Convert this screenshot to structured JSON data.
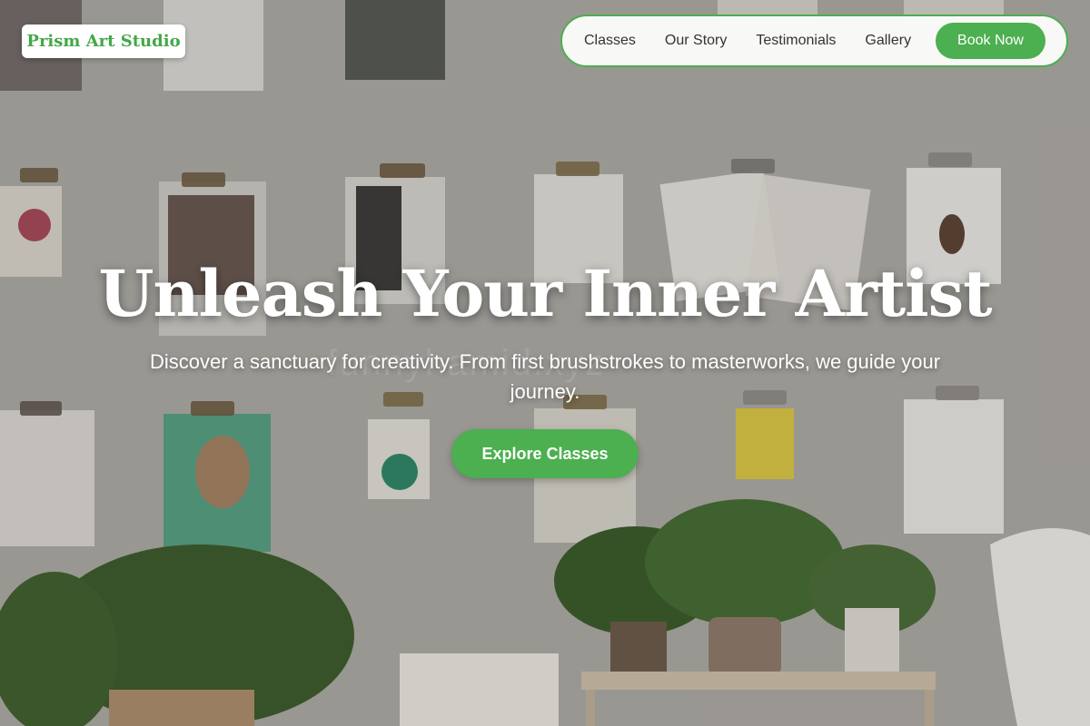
{
  "logo": {
    "text": "Prism Art Studio"
  },
  "nav": {
    "items": [
      {
        "label": "Classes"
      },
      {
        "label": "Our Story"
      },
      {
        "label": "Testimonials"
      },
      {
        "label": "Gallery"
      }
    ],
    "cta_label": "Book Now"
  },
  "hero": {
    "title": "Unleash Your Inner Artist",
    "subtitle": "Discover a sanctuary for creativity. From first brushstrokes to masterworks, we guide your journey.",
    "cta_label": "Explore Classes",
    "watermark": "funnyhamid.xyz"
  },
  "colors": {
    "accent": "#4caf50",
    "logo_text": "#43a847",
    "nav_background": "#ffffff",
    "hero_text": "#ffffff"
  }
}
